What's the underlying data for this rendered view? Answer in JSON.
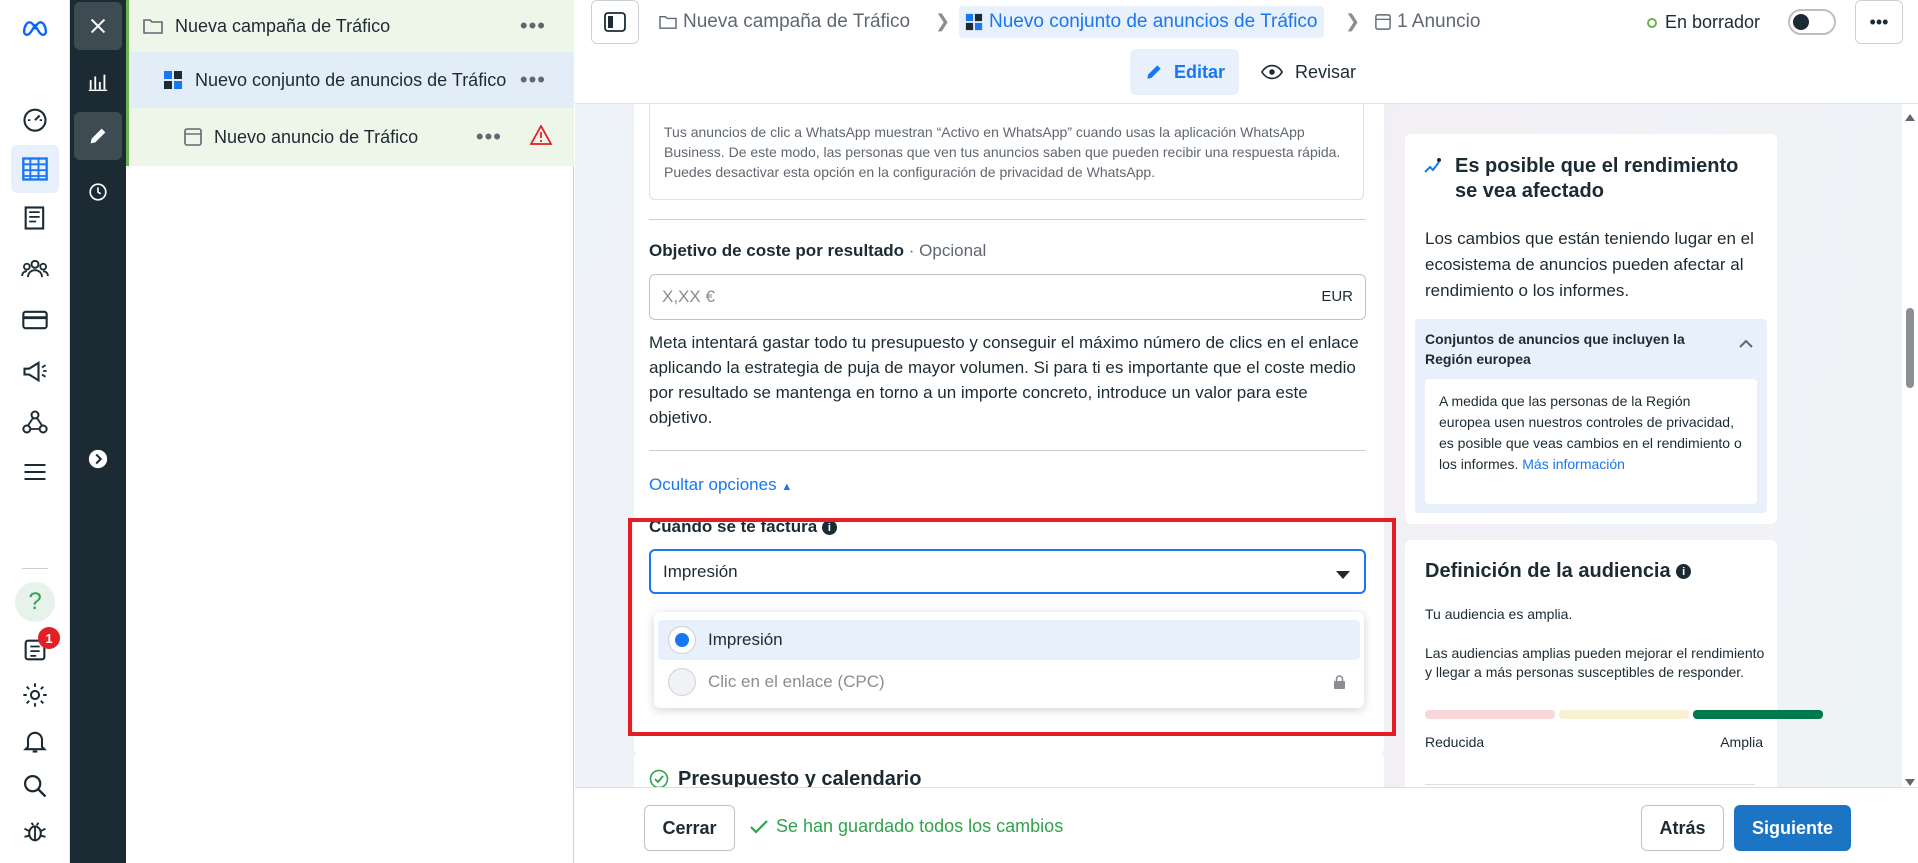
{
  "rail": {
    "logo": "meta-logo",
    "items": [
      "dashboard-icon",
      "ads-manager-icon",
      "pages-icon",
      "audiences-icon",
      "billing-icon",
      "campaign-icon",
      "network-icon",
      "menu-icon"
    ],
    "bottom": [
      "help-icon",
      "notifications-list-icon",
      "settings-icon",
      "bell-icon",
      "search-icon",
      "bug-icon"
    ],
    "notification_count": "1",
    "help_label": "?"
  },
  "tree": {
    "campaign": "Nueva campaña de Tráfico",
    "adset": "Nuevo conjunto de anuncios de Tráfico",
    "ad": "Nuevo anuncio de Tráfico",
    "more": "•••"
  },
  "topbar": {
    "crumb_campaign": "Nueva campaña de Tráfico",
    "crumb_adset": "Nuevo conjunto de anuncios de Tráfico",
    "crumb_ad": "1 Anuncio",
    "status": "En borrador",
    "more": "•••",
    "edit": "Editar",
    "review": "Revisar"
  },
  "form": {
    "whatsapp_info": "Tus anuncios de clic a WhatsApp muestran “Activo en WhatsApp” cuando usas la aplicación WhatsApp Business. De este modo, las personas que ven tus anuncios saben que pueden recibir una respuesta rápida. Puedes desactivar esta opción en la configuración de privacidad de WhatsApp.",
    "cost_label": "Objetivo de coste por resultado",
    "cost_optional": " · Opcional",
    "cost_placeholder": "X,XX €",
    "cost_currency": "EUR",
    "cost_help": "Meta intentará gastar todo tu presupuesto y conseguir el máximo número de clics en el enlace aplicando la estrategia de puja de mayor volumen. Si para ti es importante que el coste medio por resultado se mantenga en torno a un importe concreto, introduce un valor para este objetivo.",
    "hide_options": "Ocultar opciones",
    "billing_label": "Cuándo se te factura",
    "billing_selected": "Impresión",
    "billing_options": [
      "Impresión",
      "Clic en el enlace (CPC)"
    ],
    "next_section": "Presupuesto y calendario"
  },
  "perf_card": {
    "title": "Es posible que el rendimiento se vea afectado",
    "body": "Los cambios que están teniendo lugar en el ecosistema de anuncios pueden afectar al rendimiento o los informes.",
    "sub_title": "Conjuntos de anuncios que incluyen la Región europea",
    "sub_body": "A medida que las personas de la Región europea usen nuestros controles de privacidad, es posible que veas cambios en el rendimiento o los informes.",
    "sub_link": "Más información"
  },
  "aud_card": {
    "title": "Definición de la audiencia",
    "line1": "Tu audiencia es amplia.",
    "line2": "Las audiencias amplias pueden mejorar el rendimiento y llegar a más personas susceptibles de responder.",
    "min_label": "Reducida",
    "max_label": "Amplia",
    "level": "broad"
  },
  "bottombar": {
    "close": "Cerrar",
    "saved": "Se han guardado todos los cambios",
    "back": "Atrás",
    "next": "Siguiente"
  },
  "colors": {
    "accent": "#1877f2",
    "primary_button": "#1b74c4",
    "highlight": "#e41e26",
    "saved_green": "#31a24c",
    "status_dot": "#6cb34a",
    "warning": "#e41e26"
  }
}
